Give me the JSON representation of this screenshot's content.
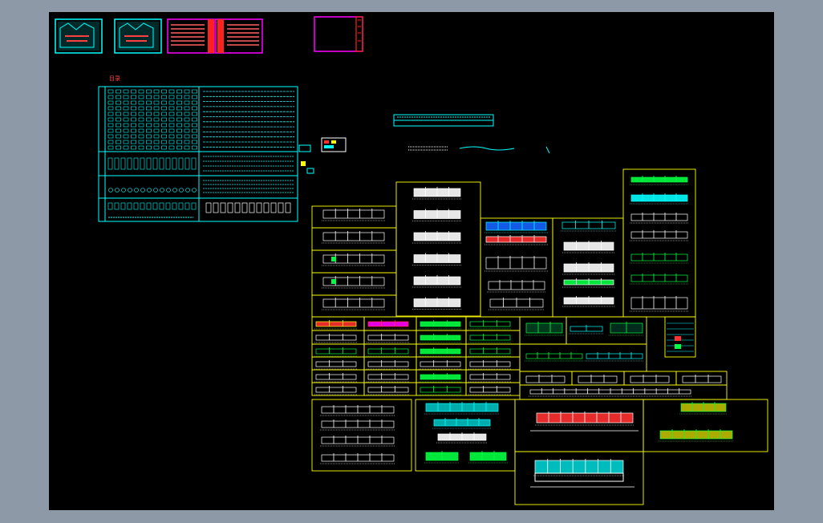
{
  "canvas": {
    "background": "#000000",
    "frame_color": "#8e99a8"
  },
  "colors": {
    "sheet_border": "#ffff00",
    "catalog_lines": "#00ffff",
    "title_frame_pink": "#ff00ff",
    "title_frame_red": "#ff2020",
    "fill_red": "#ff3030",
    "fill_cyan": "#00ffff",
    "fill_green": "#00ff40",
    "line_white": "#ffffff"
  },
  "drawing": {
    "label_tag": "目录",
    "thumbnail_count": 4,
    "elevation_sheet_count": 48
  }
}
